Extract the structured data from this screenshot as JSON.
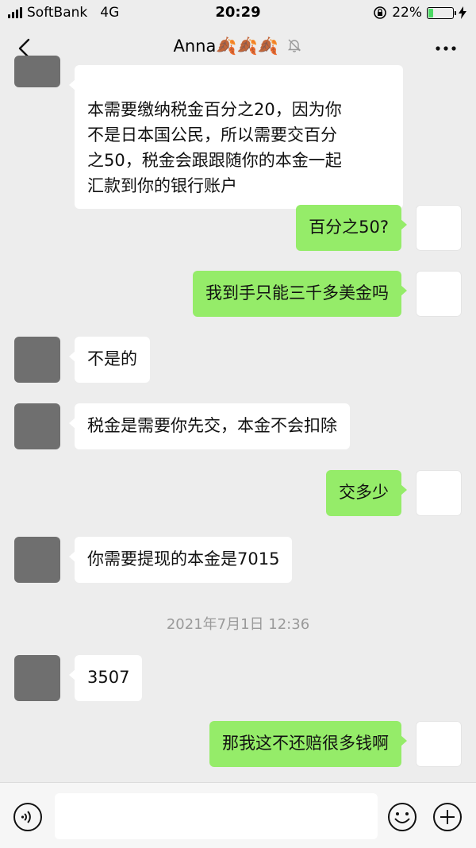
{
  "status_bar": {
    "carrier": "SoftBank",
    "network": "4G",
    "time": "20:29",
    "battery": "22%",
    "battery_level": 0.22
  },
  "nav": {
    "title": "Anna🍂🍂🍂"
  },
  "messages": [
    {
      "side": "left",
      "text": "本需要缴纳税金百分之20，因为你\n不是日本国公民，所以需要交百分\n之50，税金会跟跟随你的本金一起\n汇款到你的银行账户"
    },
    {
      "side": "right",
      "text": "百分之50?"
    },
    {
      "side": "right",
      "text": "我到手只能三千多美金吗"
    },
    {
      "side": "left",
      "text": "不是的"
    },
    {
      "side": "left",
      "text": "税金是需要你先交，本金不会扣除"
    },
    {
      "side": "right",
      "text": "交多少"
    },
    {
      "side": "left",
      "text": "你需要提现的本金是7015"
    },
    {
      "side": "left",
      "text": "3507"
    },
    {
      "side": "right",
      "text": "那我这不还赔很多钱啊"
    }
  ],
  "timestamp": "2021年7月1日 12:36",
  "input": {
    "value": ""
  },
  "colors": {
    "background": "#ededed",
    "sent_bubble": "#95ec69",
    "received_bubble": "#ffffff"
  }
}
